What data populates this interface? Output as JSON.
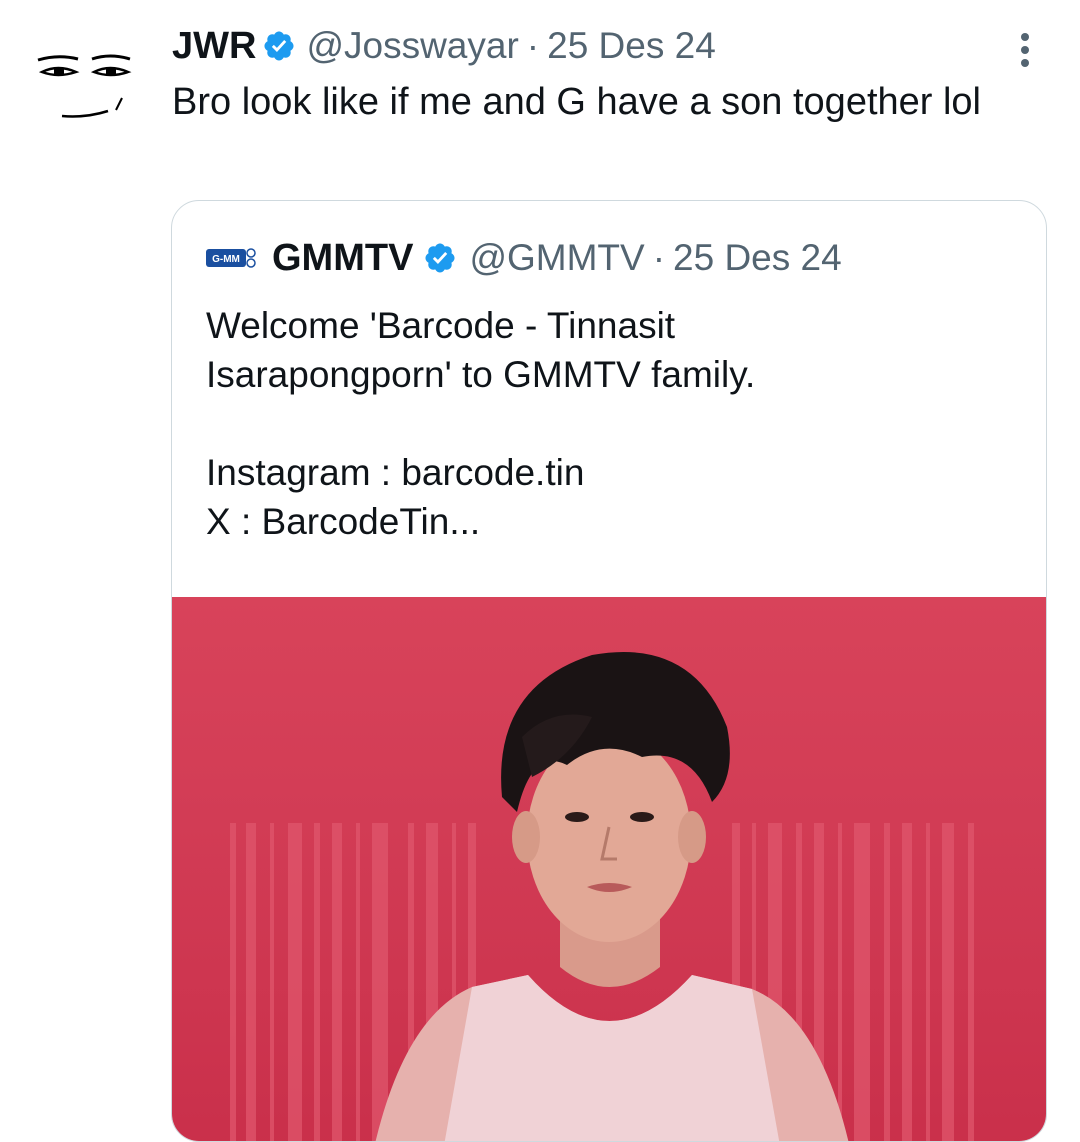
{
  "tweet": {
    "author": {
      "display_name": "JWR",
      "handle": "@Josswayar",
      "avatar_icon": "meme-face-avatar",
      "verified_icon": "verified-badge-icon"
    },
    "separator": "·",
    "date": "25 Des 24",
    "more_icon": "more-vertical-icon",
    "text": "Bro look like if me and G have a son together lol"
  },
  "quoted_tweet": {
    "author": {
      "display_name": "GMMTV",
      "handle": "@GMMTV",
      "logo_text": "G-MM",
      "verified_icon": "verified-badge-icon"
    },
    "separator": "·",
    "date": "25 Des 24",
    "text_lines": [
      "Welcome 'Barcode - Tinnasit",
      "Isarapongporn' to GMMTV family.",
      "",
      "Instagram : barcode.tin",
      "X : BarcodeTin..."
    ],
    "media": {
      "description_icon": "promo-photo",
      "background_color": "#d4405a"
    }
  },
  "colors": {
    "text_primary": "#0f1419",
    "text_secondary": "#536471",
    "verified_blue": "#1d9bf0",
    "border": "#cfd9de"
  }
}
